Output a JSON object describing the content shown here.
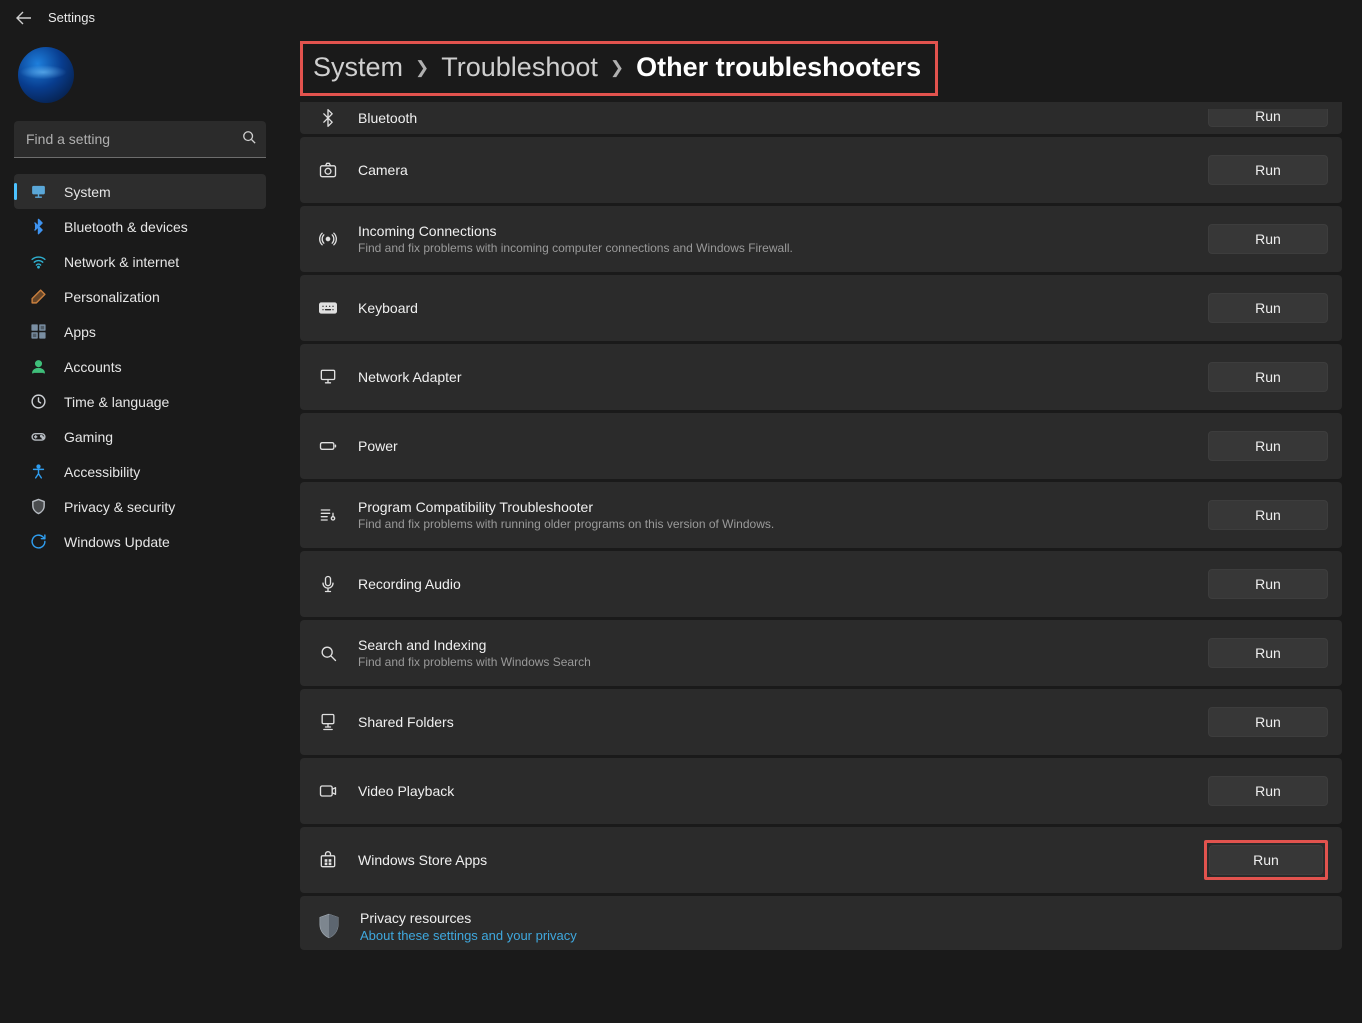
{
  "app_title": "Settings",
  "search_placeholder": "Find a setting",
  "nav": [
    {
      "label": "System",
      "icon": "display",
      "active": true,
      "color": "#5aa7d8"
    },
    {
      "label": "Bluetooth & devices",
      "icon": "bluetooth",
      "active": false,
      "color": "#3e93f0"
    },
    {
      "label": "Network & internet",
      "icon": "wifi",
      "active": false,
      "color": "#2fb0d0"
    },
    {
      "label": "Personalization",
      "icon": "brush",
      "active": false,
      "color": "#c97f3e"
    },
    {
      "label": "Apps",
      "icon": "apps",
      "active": false,
      "color": "#7a8fa3"
    },
    {
      "label": "Accounts",
      "icon": "person",
      "active": false,
      "color": "#3fbf7a"
    },
    {
      "label": "Time & language",
      "icon": "clock",
      "active": false,
      "color": "#cfd2d6"
    },
    {
      "label": "Gaming",
      "icon": "gamepad",
      "active": false,
      "color": "#b7bcc2"
    },
    {
      "label": "Accessibility",
      "icon": "accessibility",
      "active": false,
      "color": "#2f9ef0"
    },
    {
      "label": "Privacy & security",
      "icon": "shield",
      "active": false,
      "color": "#b7bcc2"
    },
    {
      "label": "Windows Update",
      "icon": "update",
      "active": false,
      "color": "#2f9ef0"
    }
  ],
  "breadcrumb": {
    "parts": [
      "System",
      "Troubleshoot"
    ],
    "current": "Other troubleshooters"
  },
  "run_label": "Run",
  "items": [
    {
      "icon": "bluetooth-pair",
      "title": "Bluetooth",
      "desc": "",
      "clipped": true
    },
    {
      "icon": "camera",
      "title": "Camera",
      "desc": ""
    },
    {
      "icon": "incoming",
      "title": "Incoming Connections",
      "desc": "Find and fix problems with incoming computer connections and Windows Firewall."
    },
    {
      "icon": "keyboard",
      "title": "Keyboard",
      "desc": ""
    },
    {
      "icon": "network-adapter",
      "title": "Network Adapter",
      "desc": ""
    },
    {
      "icon": "power",
      "title": "Power",
      "desc": ""
    },
    {
      "icon": "compat",
      "title": "Program Compatibility Troubleshooter",
      "desc": "Find and fix problems with running older programs on this version of Windows."
    },
    {
      "icon": "mic",
      "title": "Recording Audio",
      "desc": ""
    },
    {
      "icon": "search",
      "title": "Search and Indexing",
      "desc": "Find and fix problems with Windows Search"
    },
    {
      "icon": "shared-folders",
      "title": "Shared Folders",
      "desc": ""
    },
    {
      "icon": "video",
      "title": "Video Playback",
      "desc": ""
    },
    {
      "icon": "store",
      "title": "Windows Store Apps",
      "desc": "",
      "highlight_run": true
    }
  ],
  "privacy": {
    "title": "Privacy resources",
    "link": "About these settings and your privacy"
  }
}
